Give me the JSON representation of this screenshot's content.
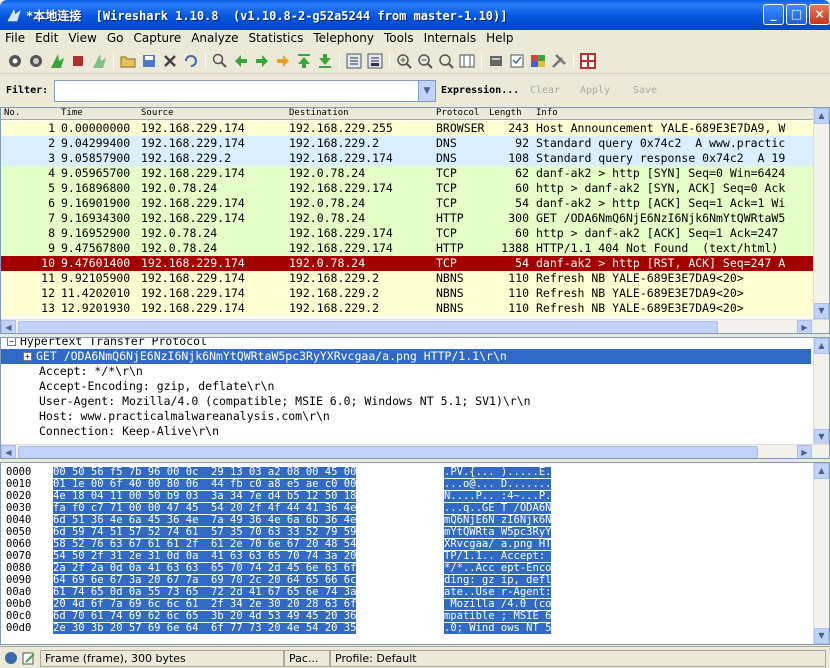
{
  "window": {
    "title": "*本地连接  [Wireshark 1.10.8  (v1.10.8-2-g52a5244 from master-1.10)]",
    "controls": [
      "_",
      "□",
      "×"
    ]
  },
  "menu": [
    "File",
    "Edit",
    "View",
    "Go",
    "Capture",
    "Analyze",
    "Statistics",
    "Telephony",
    "Tools",
    "Internals",
    "Help"
  ],
  "filter": {
    "label": "Filter:",
    "value": "",
    "expression": "Expression...",
    "clear": "Clear",
    "apply": "Apply",
    "save": "Save"
  },
  "packet_list": {
    "columns": [
      "No.",
      "Time",
      "Source",
      "Destination",
      "Protocol",
      "Length",
      "Info"
    ],
    "rows": [
      {
        "no": "1",
        "time": "0.00000000",
        "src": "192.168.229.174",
        "dst": "192.168.229.255",
        "proto": "BROWSER",
        "len": "243",
        "info": "Host Announcement YALE-689E3E7DA9, W"
      },
      {
        "no": "2",
        "time": "9.04299400",
        "src": "192.168.229.174",
        "dst": "192.168.229.2",
        "proto": "DNS",
        "len": "92",
        "info": "Standard query 0x74c2  A www.practic"
      },
      {
        "no": "3",
        "time": "9.05857900",
        "src": "192.168.229.2",
        "dst": "192.168.229.174",
        "proto": "DNS",
        "len": "108",
        "info": "Standard query response 0x74c2  A 19"
      },
      {
        "no": "4",
        "time": "9.05965700",
        "src": "192.168.229.174",
        "dst": "192.0.78.24",
        "proto": "TCP",
        "len": "62",
        "info": "danf-ak2 > http [SYN] Seq=0 Win=6424"
      },
      {
        "no": "5",
        "time": "9.16896800",
        "src": "192.0.78.24",
        "dst": "192.168.229.174",
        "proto": "TCP",
        "len": "60",
        "info": "http > danf-ak2 [SYN, ACK] Seq=0 Ack"
      },
      {
        "no": "6",
        "time": "9.16901900",
        "src": "192.168.229.174",
        "dst": "192.0.78.24",
        "proto": "TCP",
        "len": "54",
        "info": "danf-ak2 > http [ACK] Seq=1 Ack=1 Wi"
      },
      {
        "no": "7",
        "time": "9.16934300",
        "src": "192.168.229.174",
        "dst": "192.0.78.24",
        "proto": "HTTP",
        "len": "300",
        "info": "GET /ODA6NmQ6NjE6NzI6Njk6NmYtQWRtaW5"
      },
      {
        "no": "8",
        "time": "9.16952900",
        "src": "192.0.78.24",
        "dst": "192.168.229.174",
        "proto": "TCP",
        "len": "60",
        "info": "http > danf-ak2 [ACK] Seq=1 Ack=247"
      },
      {
        "no": "9",
        "time": "9.47567800",
        "src": "192.0.78.24",
        "dst": "192.168.229.174",
        "proto": "HTTP",
        "len": "1388",
        "info": "HTTP/1.1 404 Not Found  (text/html)"
      },
      {
        "no": "10",
        "time": "9.47601400",
        "src": "192.168.229.174",
        "dst": "192.0.78.24",
        "proto": "TCP",
        "len": "54",
        "info": "danf-ak2 > http [RST, ACK] Seq=247 A"
      },
      {
        "no": "11",
        "time": "9.92105900",
        "src": "192.168.229.174",
        "dst": "192.168.229.2",
        "proto": "NBNS",
        "len": "110",
        "info": "Refresh NB YALE-689E3E7DA9<20>"
      },
      {
        "no": "12",
        "time": "11.4202010",
        "src": "192.168.229.174",
        "dst": "192.168.229.2",
        "proto": "NBNS",
        "len": "110",
        "info": "Refresh NB YALE-689E3E7DA9<20>"
      },
      {
        "no": "13",
        "time": "12.9201930",
        "src": "192.168.229.174",
        "dst": "192.168.229.2",
        "proto": "NBNS",
        "len": "110",
        "info": "Refresh NB YALE-689E3E7DA9<20>"
      }
    ],
    "row_colors": [
      "#fffdd2",
      "#daeefe",
      "#daeefe",
      "#e4ffc7",
      "#e4ffc7",
      "#e4ffc7",
      "#e4ffc7",
      "#e4ffc7",
      "#e4ffc7",
      "#a40000",
      "#fffdd2",
      "#fffdd2",
      "#fffdd2"
    ],
    "selected_row": 9
  },
  "details": {
    "lines": [
      {
        "text": "Hypertext Transfer Protocol",
        "expander": "minus",
        "indent": 0
      },
      {
        "text": "GET /ODA6NmQ6NjE6NzI6Njk6NmYtQWRtaW5pc3RyYXRvcgaa/a.png HTTP/1.1\\r\\n",
        "expander": "plus",
        "indent": 1,
        "selected": true
      },
      {
        "text": "Accept: */*\\r\\n",
        "indent": 2
      },
      {
        "text": "Accept-Encoding: gzip, deflate\\r\\n",
        "indent": 2
      },
      {
        "text": "User-Agent: Mozilla/4.0 (compatible; MSIE 6.0; Windows NT 5.1; SV1)\\r\\n",
        "indent": 2
      },
      {
        "text": "Host: www.practicalmalwareanalysis.com\\r\\n",
        "indent": 2
      },
      {
        "text": "Connection: Keep-Alive\\r\\n",
        "indent": 2
      }
    ]
  },
  "hex": {
    "lines": [
      {
        "offset": "0000",
        "hex": "00 50 56 f5 7b 96 00 0c  29 13 03 a2 08 00 45 00",
        "ascii": ".PV.{... ).....E."
      },
      {
        "offset": "0010",
        "hex": "01 1e 00 6f 40 00 80 06  44 fb c0 a8 e5 ae c0 00",
        "ascii": "...o@... D......."
      },
      {
        "offset": "0020",
        "hex": "4e 18 04 11 00 50 b9 03  3a 34 7e d4 b5 12 50 18",
        "ascii": "N....P.. :4~...P."
      },
      {
        "offset": "0030",
        "hex": "fa f0 c7 71 00 00 47 45  54 20 2f 4f 44 41 36 4e",
        "ascii": "...q..GE T /ODA6N"
      },
      {
        "offset": "0040",
        "hex": "6d 51 36 4e 6a 45 36 4e  7a 49 36 4e 6a 6b 36 4e",
        "ascii": "mQ6NjE6N zI6Njk6N"
      },
      {
        "offset": "0050",
        "hex": "6d 59 74 51 57 52 74 61  57 35 70 63 33 52 79 59",
        "ascii": "mYtQWRta W5pc3RyY"
      },
      {
        "offset": "0060",
        "hex": "58 52 76 63 67 61 61 2f  61 2e 70 6e 67 20 48 54",
        "ascii": "XRvcgaa/ a.png HT"
      },
      {
        "offset": "0070",
        "hex": "54 50 2f 31 2e 31 0d 0a  41 63 63 65 70 74 3a 20",
        "ascii": "TP/1.1.. Accept: "
      },
      {
        "offset": "0080",
        "hex": "2a 2f 2a 0d 0a 41 63 63  65 70 74 2d 45 6e 63 6f",
        "ascii": "*/*..Acc ept-Enco"
      },
      {
        "offset": "0090",
        "hex": "64 69 6e 67 3a 20 67 7a  69 70 2c 20 64 65 66 6c",
        "ascii": "ding: gz ip, defl"
      },
      {
        "offset": "00a0",
        "hex": "61 74 65 0d 0a 55 73 65  72 2d 41 67 65 6e 74 3a",
        "ascii": "ate..Use r-Agent:"
      },
      {
        "offset": "00b0",
        "hex": "20 4d 6f 7a 69 6c 6c 61  2f 34 2e 30 20 28 63 6f",
        "ascii": " Mozilla /4.0 (co"
      },
      {
        "offset": "00c0",
        "hex": "6d 70 61 74 69 62 6c 65  3b 20 4d 53 49 45 20 36",
        "ascii": "mpatible ; MSIE 6"
      },
      {
        "offset": "00d0",
        "hex": "2e 30 3b 20 57 69 6e 64  6f 77 73 20 4e 54 20 35",
        "ascii": ".0; Wind ows NT 5"
      }
    ]
  },
  "status": {
    "frame": "Frame (frame), 300 bytes",
    "packets": "Pac...",
    "profile": "Profile: Default"
  }
}
